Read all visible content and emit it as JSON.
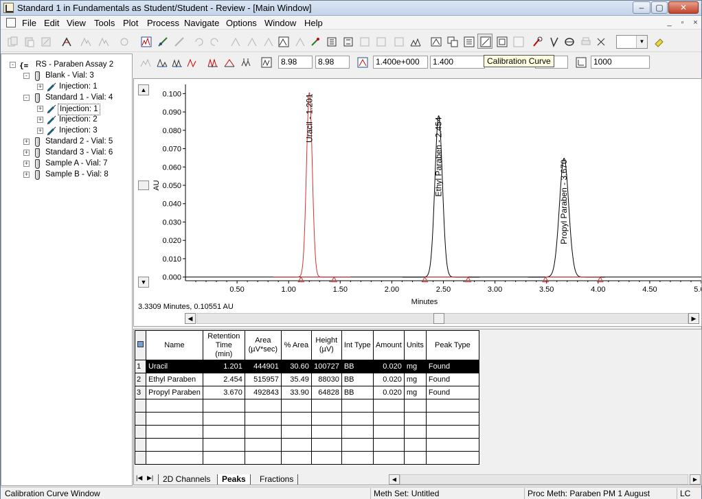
{
  "window": {
    "title": "Standard 1 in Fundamentals as Student/Student - Review - [Main Window]",
    "controls": [
      "–",
      "▢",
      "✕"
    ]
  },
  "menu": [
    "File",
    "Edit",
    "View",
    "Tools",
    "Plot",
    "Process",
    "Navigate",
    "Options",
    "Window",
    "Help"
  ],
  "toolbar2": {
    "field1": "8.98",
    "field2": "8.98",
    "field3": "1.400e+000",
    "field4": "1.400",
    "field5": "1000",
    "tooltip": "Calibration Curve"
  },
  "tree": [
    {
      "label": "RS - Paraben Assay 2",
      "icon": "result-set-icon",
      "level": 0,
      "expander": "-"
    },
    {
      "label": "Blank - Vial: 3",
      "icon": "vial-icon",
      "level": 1,
      "expander": "-"
    },
    {
      "label": "Injection: 1",
      "icon": "syringe-icon",
      "level": 2,
      "expander": "+"
    },
    {
      "label": "Standard 1 - Vial: 4",
      "icon": "vial-icon",
      "level": 1,
      "expander": "-"
    },
    {
      "label": "Injection: 1",
      "icon": "syringe-icon",
      "level": 2,
      "expander": "+",
      "selected": true
    },
    {
      "label": "Injection: 2",
      "icon": "syringe-icon",
      "level": 2,
      "expander": "+"
    },
    {
      "label": "Injection: 3",
      "icon": "syringe-icon",
      "level": 2,
      "expander": "+"
    },
    {
      "label": "Standard 2 - Vial: 5",
      "icon": "vial-icon",
      "level": 1,
      "expander": "+"
    },
    {
      "label": "Standard 3 - Vial: 6",
      "icon": "vial-icon",
      "level": 1,
      "expander": "+"
    },
    {
      "label": "Sample A - Vial: 7",
      "icon": "vial-icon",
      "level": 1,
      "expander": "+"
    },
    {
      "label": "Sample B - Vial: 8",
      "icon": "vial-icon",
      "level": 1,
      "expander": "+"
    }
  ],
  "chart_data": {
    "type": "line",
    "xlabel": "Minutes",
    "ylabel": "AU",
    "xlim": [
      0.0,
      5.0
    ],
    "ylim": [
      -0.002,
      0.105
    ],
    "x_ticks": [
      "0.50",
      "1.00",
      "1.50",
      "2.00",
      "2.50",
      "3.00",
      "3.50",
      "4.00",
      "4.50",
      "5.00"
    ],
    "y_ticks": [
      "0.000",
      "0.010",
      "0.020",
      "0.030",
      "0.040",
      "0.050",
      "0.060",
      "0.070",
      "0.080",
      "0.090",
      "0.100"
    ],
    "grid": false,
    "cursor_readout": "3.3309 Minutes, 0.10551 AU",
    "peaks": [
      {
        "name": "Uracil",
        "label": "Uracil - 1.201",
        "rt": 1.201,
        "height": 0.1007,
        "sigma": 0.028,
        "start": 1.12,
        "end": 1.44,
        "color": "#d83030"
      },
      {
        "name": "Ethyl Paraben",
        "label": "Ethyl Paraben - 2.454",
        "rt": 2.454,
        "height": 0.088,
        "sigma": 0.036,
        "start": 2.32,
        "end": 2.74,
        "color": "#000000"
      },
      {
        "name": "Propyl Paraben",
        "label": "Propyl Paraben - 3.670",
        "rt": 3.67,
        "height": 0.0648,
        "sigma": 0.045,
        "start": 3.49,
        "end": 4.02,
        "color": "#000000"
      }
    ],
    "baseline_marker_color": "#d83030"
  },
  "peaks_table": {
    "headers": [
      "Name",
      "Retention Time (min)",
      "Area (µV*sec)",
      "% Area",
      "Height (µV)",
      "Int Type",
      "Amount",
      "Units",
      "Peak Type"
    ],
    "rows": [
      {
        "n": "1",
        "name": "Uracil",
        "rt": "1.201",
        "area": "444901",
        "pct": "30.60",
        "height": "100727",
        "int": "BB",
        "amount": "0.020",
        "units": "mg",
        "type": "Found"
      },
      {
        "n": "2",
        "name": "Ethyl Paraben",
        "rt": "2.454",
        "area": "515957",
        "pct": "35.49",
        "height": "88030",
        "int": "BB",
        "amount": "0.020",
        "units": "mg",
        "type": "Found"
      },
      {
        "n": "3",
        "name": "Propyl Paraben",
        "rt": "3.670",
        "area": "492843",
        "pct": "33.90",
        "height": "64828",
        "int": "BB",
        "amount": "0.020",
        "units": "mg",
        "type": "Found"
      }
    ],
    "selected_row": 0
  },
  "tabs": [
    "2D Channels",
    "Peaks",
    "Fractions"
  ],
  "active_tab": "Peaks",
  "status": {
    "left": "Calibration Curve Window",
    "meth_set": "Meth Set: Untitled",
    "proc_meth": "Proc Meth: Paraben PM 1 August",
    "mode": "LC"
  }
}
